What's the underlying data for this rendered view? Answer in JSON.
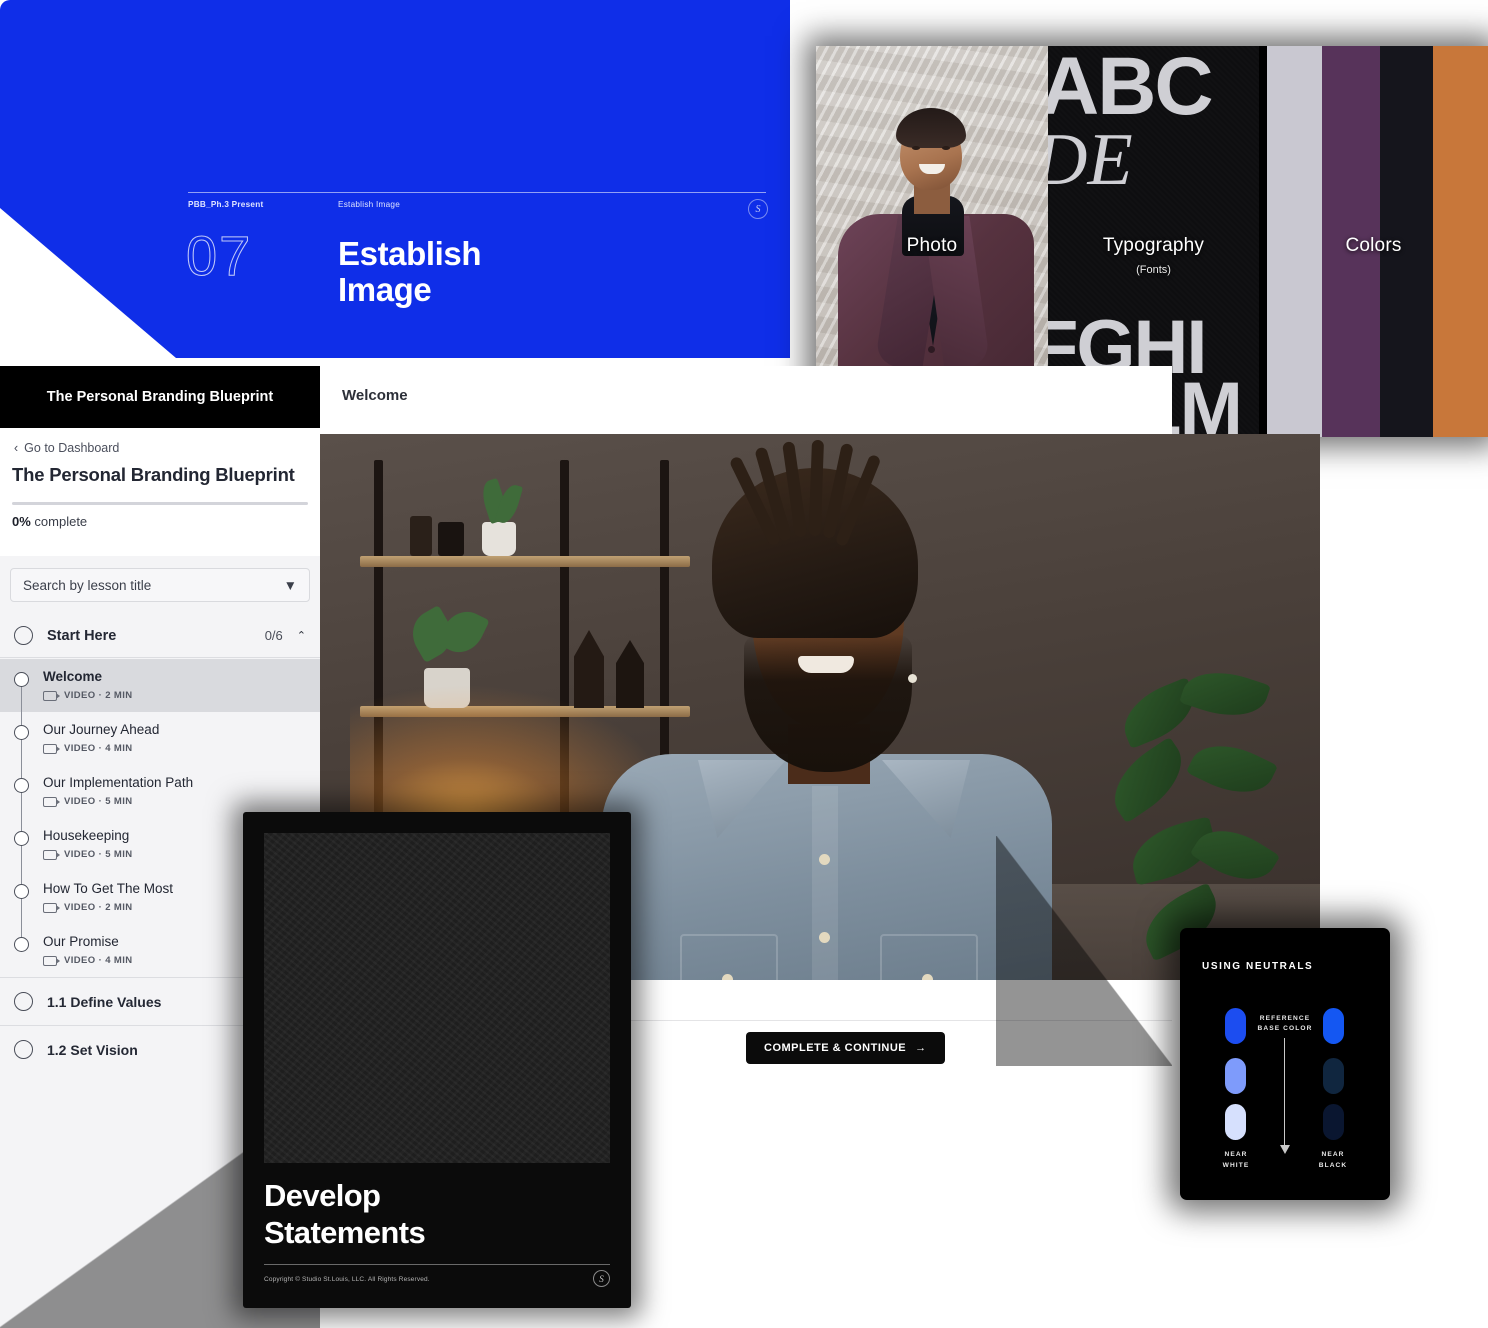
{
  "presentation_slide": {
    "meta_left": "PBB_Ph.3 Present",
    "meta_right": "Establish Image",
    "number": "07",
    "title": "Establish\nImage",
    "title_line1": "Establish",
    "title_line2": "Image",
    "logo_glyph": "S",
    "background_color": "#0f2ee8"
  },
  "brand_collage": {
    "photo_label": "Photo",
    "typography_label": "Typography",
    "typography_sublabel": "(Fonts)",
    "colors_label": "Colors",
    "type_specimen": {
      "row1": "ABC",
      "row2": "DE",
      "row3": "FGHI",
      "row4": "JKLM"
    },
    "swatches": [
      {
        "name": "light-gray",
        "hex": "#c9c8d1"
      },
      {
        "name": "plum",
        "hex": "#57335a"
      },
      {
        "name": "near-black",
        "hex": "#15151c"
      },
      {
        "name": "burnt-orange",
        "hex": "#c8773a"
      }
    ]
  },
  "course_player": {
    "lesson_title": "Welcome",
    "complete_button": "COMPLETE & CONTINUE",
    "complete_button_arrow": "→"
  },
  "sidebar": {
    "topbar_title": "The Personal Branding Blueprint",
    "back_link": "Go to Dashboard",
    "back_chevron": "‹",
    "course_title": "The Personal Branding Blueprint",
    "progress_percent": "0%",
    "progress_label_suffix": " complete",
    "progress_value": 0,
    "search": {
      "placeholder": "Search by lesson title",
      "value": "Search by lesson title",
      "caret": "▼"
    },
    "section": {
      "label": "Start Here",
      "count": "0/6",
      "chevron": "⌃",
      "expanded": true
    },
    "lessons": [
      {
        "title": "Welcome",
        "type": "VIDEO",
        "duration": "2 MIN",
        "meta": "VIDEO · 2 MIN",
        "active": true
      },
      {
        "title": "Our Journey Ahead",
        "type": "VIDEO",
        "duration": "4 MIN",
        "meta": "VIDEO · 4 MIN",
        "active": false
      },
      {
        "title": "Our Implementation Path",
        "type": "VIDEO",
        "duration": "5 MIN",
        "meta": "VIDEO · 5 MIN",
        "active": false
      },
      {
        "title": "Housekeeping",
        "type": "VIDEO",
        "duration": "5 MIN",
        "meta": "VIDEO · 5 MIN",
        "active": false
      },
      {
        "title": "How To Get The Most",
        "type": "VIDEO",
        "duration": "2 MIN",
        "meta": "VIDEO · 2 MIN",
        "active": false
      },
      {
        "title": "Our Promise",
        "type": "VIDEO",
        "duration": "4 MIN",
        "meta": "VIDEO · 4 MIN",
        "active": false
      }
    ],
    "other_sections": [
      {
        "label": "1.1 Define Values"
      },
      {
        "label": "1.2 Set Vision"
      }
    ]
  },
  "statements_card": {
    "title_line1": "Develop",
    "title_line2": "Statements",
    "copyright": "Copyright © Studio St.Louis, LLC. All Rights Reserved.",
    "logo_glyph": "S"
  },
  "neutrals_card": {
    "title": "USING NEUTRALS",
    "reference_label": "REFERENCE\nBASE COLOR",
    "reference_line1": "REFERENCE",
    "reference_line2": "BASE COLOR",
    "near_white_line1": "NEAR",
    "near_white_line2": "WHITE",
    "near_black_line1": "NEAR",
    "near_black_line2": "BLACK",
    "left_column": [
      {
        "hex": "#1c4df0"
      },
      {
        "hex": "#7e9bfb"
      },
      {
        "hex": "#d6e0fd"
      }
    ],
    "right_column": [
      {
        "hex": "#1457f2"
      },
      {
        "hex": "#10263f"
      },
      {
        "hex": "#0a1630"
      }
    ]
  }
}
